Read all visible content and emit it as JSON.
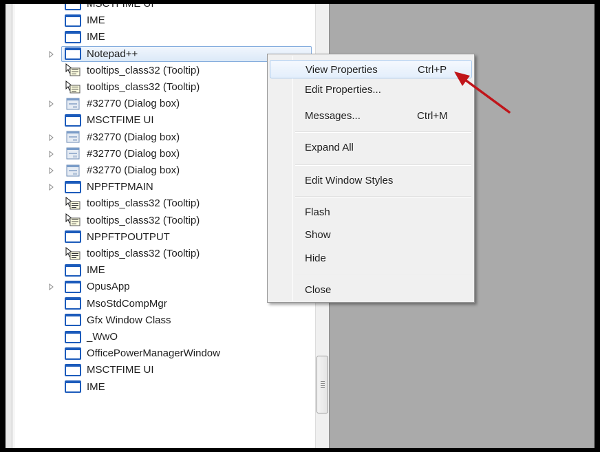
{
  "colors": {
    "frame": "#000000",
    "right_pane": "#aaaaaa",
    "menu_bg": "#f0f0f0",
    "highlight_border": "#a8c8ec",
    "window_icon_blue": "#1c5bbb",
    "annotation_arrow": "#c0151a"
  },
  "tree": {
    "rows": [
      {
        "label": "MSCTFIME UI",
        "icon": "window-icon",
        "expandable": false
      },
      {
        "label": "IME",
        "icon": "window-icon",
        "expandable": false
      },
      {
        "label": "IME",
        "icon": "window-icon",
        "expandable": false
      },
      {
        "label": "Notepad++",
        "icon": "window-icon",
        "expandable": true,
        "selected": true
      },
      {
        "label": "tooltips_class32 (Tooltip)",
        "icon": "tooltip-icon",
        "expandable": false
      },
      {
        "label": "tooltips_class32 (Tooltip)",
        "icon": "tooltip-icon",
        "expandable": false
      },
      {
        "label": "#32770 (Dialog box)",
        "icon": "dialog-icon",
        "expandable": true
      },
      {
        "label": "MSCTFIME UI",
        "icon": "window-icon",
        "expandable": false
      },
      {
        "label": "#32770 (Dialog box)",
        "icon": "dialog-icon",
        "expandable": true
      },
      {
        "label": "#32770 (Dialog box)",
        "icon": "dialog-icon",
        "expandable": true
      },
      {
        "label": "#32770 (Dialog box)",
        "icon": "dialog-icon",
        "expandable": true
      },
      {
        "label": "NPPFTPMAIN",
        "icon": "window-icon",
        "expandable": true
      },
      {
        "label": "tooltips_class32 (Tooltip)",
        "icon": "tooltip-icon",
        "expandable": false
      },
      {
        "label": "tooltips_class32 (Tooltip)",
        "icon": "tooltip-icon",
        "expandable": false
      },
      {
        "label": "NPPFTPOUTPUT",
        "icon": "window-icon",
        "expandable": false
      },
      {
        "label": "tooltips_class32 (Tooltip)",
        "icon": "tooltip-icon",
        "expandable": false
      },
      {
        "label": "IME",
        "icon": "window-icon",
        "expandable": false
      },
      {
        "label": "OpusApp",
        "icon": "window-icon",
        "expandable": true
      },
      {
        "label": "MsoStdCompMgr",
        "icon": "window-icon",
        "expandable": false
      },
      {
        "label": "Gfx Window Class",
        "icon": "window-icon",
        "expandable": false
      },
      {
        "label": "_WwO",
        "icon": "window-icon",
        "expandable": false
      },
      {
        "label": "OfficePowerManagerWindow",
        "icon": "window-icon",
        "expandable": false
      },
      {
        "label": "MSCTFIME UI",
        "icon": "window-icon",
        "expandable": false
      },
      {
        "label": "IME",
        "icon": "window-icon",
        "expandable": false
      }
    ]
  },
  "context_menu": {
    "items": [
      {
        "label": "View Properties",
        "shortcut": "Ctrl+P",
        "highlighted": true
      },
      {
        "label": "Edit Properties...",
        "shortcut": ""
      },
      {
        "label": "Messages...",
        "shortcut": "Ctrl+M"
      },
      {
        "separator": true
      },
      {
        "label": "Expand All",
        "shortcut": ""
      },
      {
        "separator": true
      },
      {
        "label": "Edit Window Styles",
        "shortcut": ""
      },
      {
        "separator": true
      },
      {
        "label": "Flash",
        "shortcut": ""
      },
      {
        "label": "Show",
        "shortcut": ""
      },
      {
        "label": "Hide",
        "shortcut": ""
      },
      {
        "separator": true
      },
      {
        "label": "Close",
        "shortcut": ""
      }
    ]
  }
}
